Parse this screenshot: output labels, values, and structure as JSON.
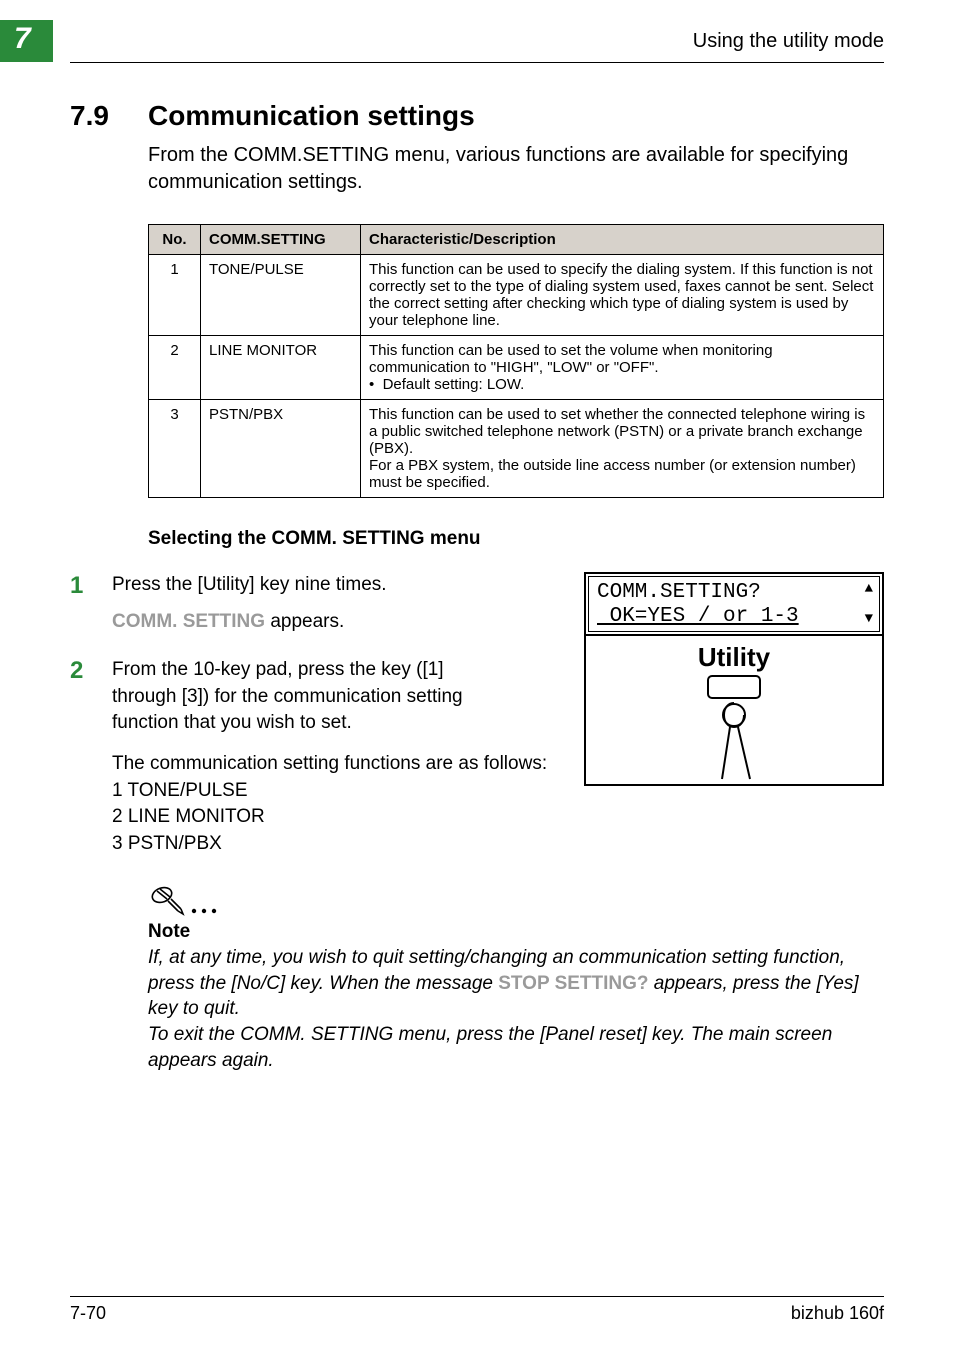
{
  "chapterNumber": "7",
  "headerRight": "Using the utility mode",
  "section": {
    "number": "7.9",
    "title": "Communication settings",
    "intro": "From the COMM.SETTING menu, various functions are available for specifying communication settings."
  },
  "table": {
    "headers": {
      "no": "No.",
      "setting": "COMM.SETTING",
      "desc": "Characteristic/Description"
    },
    "rows": [
      {
        "no": "1",
        "setting": "TONE/PULSE",
        "desc": "This function can be used to specify the dialing system. If this function is not correctly set to the type of dialing system used, faxes cannot be sent. Select the correct setting after checking which type of dialing system is used by your telephone line."
      },
      {
        "no": "2",
        "setting": "LINE MONITOR",
        "desc_line1": "This function can be used to set the volume when monitoring communication to \"HIGH\", \"LOW\" or \"OFF\".",
        "bullet": "Default setting: LOW."
      },
      {
        "no": "3",
        "setting": "PSTN/PBX",
        "desc": "This function can be used to set whether the connected telephone wiring is a public switched telephone network (PSTN) or a private branch exchange (PBX).\nFor a PBX system, the outside line access number (or extension number) must be specified."
      }
    ]
  },
  "subheading": "Selecting the COMM. SETTING menu",
  "steps": {
    "s1": {
      "num": "1",
      "line1": "Press the [Utility] key nine times.",
      "greyLabel": "COMM. SETTING",
      "line2_after": " appears."
    },
    "s2": {
      "num": "2",
      "para1": "From the 10-key pad, press the key ([1] through [3]) for the communication setting function that you wish to set.",
      "para2": "The communication setting functions are as follows:",
      "list1": "1 TONE/PULSE",
      "list2": "2 LINE MONITOR",
      "list3": "3 PSTN/PBX"
    }
  },
  "lcd": {
    "line1": "COMM.SETTING?",
    "line2": " OK=YES / or 1-3"
  },
  "utilityLabel": "Utility",
  "note": {
    "heading": "Note",
    "part1": "If, at any time, you wish to quit setting/changing an communication setting function, press the [No/C] key. When the message ",
    "grey": "STOP SETTING?",
    "part2": " appears, press the [Yes] key to quit.",
    "part3": "To exit the COMM. SETTING menu, press the [Panel reset] key. The main screen appears again."
  },
  "footer": {
    "left": "7-70",
    "right": "bizhub 160f"
  }
}
